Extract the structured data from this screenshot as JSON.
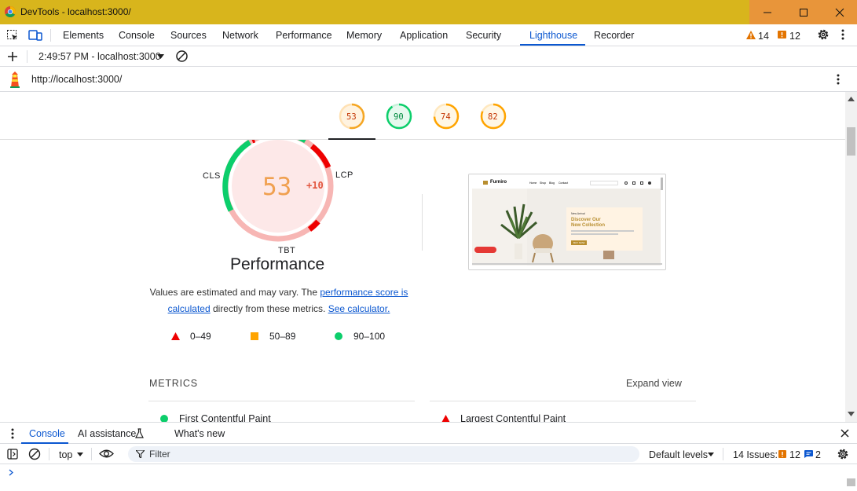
{
  "window": {
    "title": "DevTools - localhost:3000/"
  },
  "tabs": [
    "Elements",
    "Console",
    "Sources",
    "Network",
    "Performance",
    "Memory",
    "Application",
    "Security",
    "Lighthouse",
    "Recorder"
  ],
  "active_tab": "Lighthouse",
  "counts": {
    "warnings": "14",
    "issues": "12"
  },
  "report_selector": {
    "label": "2:49:57 PM - localhost:3000"
  },
  "url": "http://localhost:3000/",
  "scores": [
    {
      "value": "53",
      "color": "#e67700"
    },
    {
      "value": "90",
      "color": "#0cce6b"
    },
    {
      "value": "74",
      "color": "#ffa400"
    },
    {
      "value": "82",
      "color": "#ffa400"
    }
  ],
  "performance": {
    "score": "53",
    "delta": "+10",
    "title": "Performance",
    "labels": {
      "cls": "CLS",
      "lcp": "LCP",
      "tbt": "TBT"
    },
    "desc_part1": "Values are estimated and may vary. The ",
    "link1": "performance score is calculated",
    "desc_part2": " directly from these metrics. ",
    "link2": "See calculator."
  },
  "legend": [
    {
      "range": "0–49",
      "shape": "triangle",
      "color": "#e00"
    },
    {
      "range": "50–89",
      "shape": "square",
      "color": "#ffa400"
    },
    {
      "range": "90–100",
      "shape": "circle",
      "color": "#0cce6b"
    }
  ],
  "metrics": {
    "heading": "METRICS",
    "expand": "Expand view",
    "items": [
      "First Contentful Paint",
      "Largest Contentful Paint"
    ]
  },
  "screenshot": {
    "brand": "Furniro",
    "nav": [
      "Home",
      "Shop",
      "Blog",
      "Contact"
    ],
    "hero_kicker": "New Arrival",
    "hero_title1": "Discover Our",
    "hero_title2": "New Collection",
    "hero_button": "BUY NOW"
  },
  "drawer": {
    "tabs": [
      "Console",
      "AI assistance",
      "What's new"
    ],
    "context": "top",
    "filter_placeholder": "Filter",
    "levels": "Default levels",
    "issues_label": "14 Issues:",
    "issue_warn": "12",
    "issue_info": "2"
  }
}
